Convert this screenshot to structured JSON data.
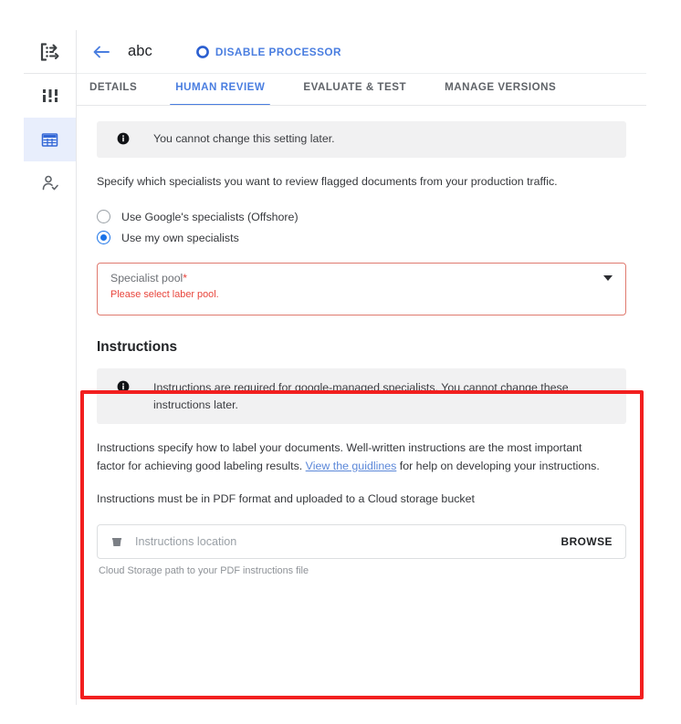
{
  "colors": {
    "accent_blue": "#4a7ee0",
    "radio_blue": "#1a73e8",
    "error_red": "#e8453c",
    "error_border": "#e07a6f",
    "annotation_red": "#f21f1f",
    "banner_gray": "#f1f1f2",
    "rail_active_bg": "#e8eefc",
    "link_blue": "#5b87d8"
  },
  "sidebar": {
    "items": [
      {
        "icon": "processor-list-icon",
        "name": "sidebar-item-overview",
        "active": false
      },
      {
        "icon": "dashboard-bars-icon",
        "name": "sidebar-item-dashboard",
        "active": false
      },
      {
        "icon": "table-grid-icon",
        "name": "sidebar-item-processors",
        "active": true
      },
      {
        "icon": "person-check-icon",
        "name": "sidebar-item-human-review",
        "active": false
      }
    ]
  },
  "header": {
    "back_icon": "arrow-left-icon",
    "title": "abc",
    "disable_button": {
      "icon": "stop-circle-icon",
      "label": "DISABLE PROCESSOR"
    }
  },
  "tabs": [
    {
      "label": "DETAILS",
      "active": false
    },
    {
      "label": "HUMAN REVIEW",
      "active": true
    },
    {
      "label": "EVALUATE & TEST",
      "active": false
    },
    {
      "label": "MANAGE VERSIONS",
      "active": false
    }
  ],
  "human_review": {
    "top_banner": {
      "icon": "info-icon",
      "text": "You cannot change this setting later."
    },
    "intro_paragraph": "Specify which specialists you want to review flagged documents from your production traffic.",
    "radios": [
      {
        "label": "Use Google's specialists (Offshore)",
        "selected": false
      },
      {
        "label": "Use my own specialists",
        "selected": true
      }
    ],
    "specialist_pool": {
      "label": "Specialist pool",
      "required_marker": "*",
      "value": "",
      "error": "Please select laber pool.",
      "caret_icon": "chevron-down-icon"
    }
  },
  "instructions": {
    "heading": "Instructions",
    "banner": {
      "icon": "info-icon",
      "text": "Instructions are required for google-managed specialists. You cannot change these instructions later."
    },
    "paragraph_part1": "Instructions specify how to label your documents. Well-written instructions are the most important factor for achieving good labeling results. ",
    "link_text": "View the guidlines",
    "paragraph_part2": " for help on developing your instructions.",
    "format_note": "Instructions must be in PDF format and uploaded to a Cloud storage bucket",
    "location_field": {
      "icon": "storage-bucket-icon",
      "value": "",
      "placeholder": "Instructions location",
      "browse_label": "BROWSE",
      "help_text": "Cloud Storage path to your PDF instructions file"
    }
  },
  "annotation": {
    "name": "instructions-highlight-box"
  }
}
